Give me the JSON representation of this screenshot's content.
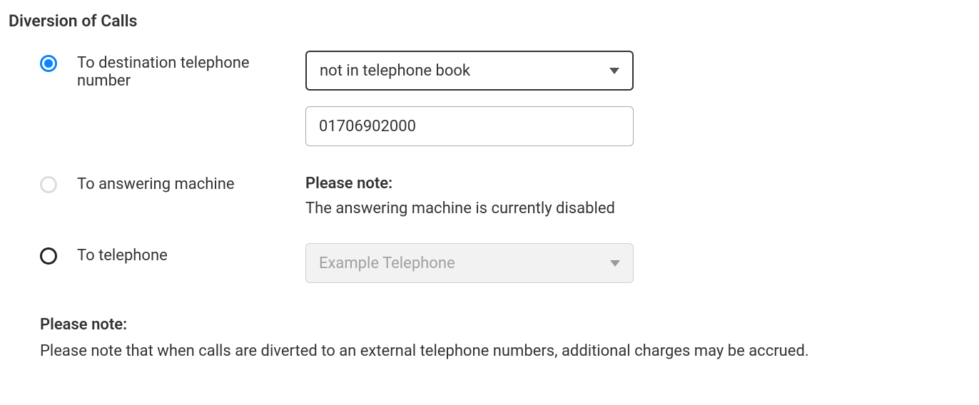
{
  "section": {
    "title": "Diversion of Calls"
  },
  "options": {
    "destination": {
      "label": "To destination telephone number",
      "select_value": "not in telephone book",
      "input_value": "01706902000"
    },
    "answering_machine": {
      "label": "To answering machine",
      "note_title": "Please note:",
      "note_text": "The answering machine is currently disabled"
    },
    "telephone": {
      "label": "To telephone",
      "select_value": "Example Telephone"
    }
  },
  "footer_note": {
    "title": "Please note:",
    "text": "Please note that when calls are diverted to an external telephone numbers, additional charges may be accrued."
  }
}
